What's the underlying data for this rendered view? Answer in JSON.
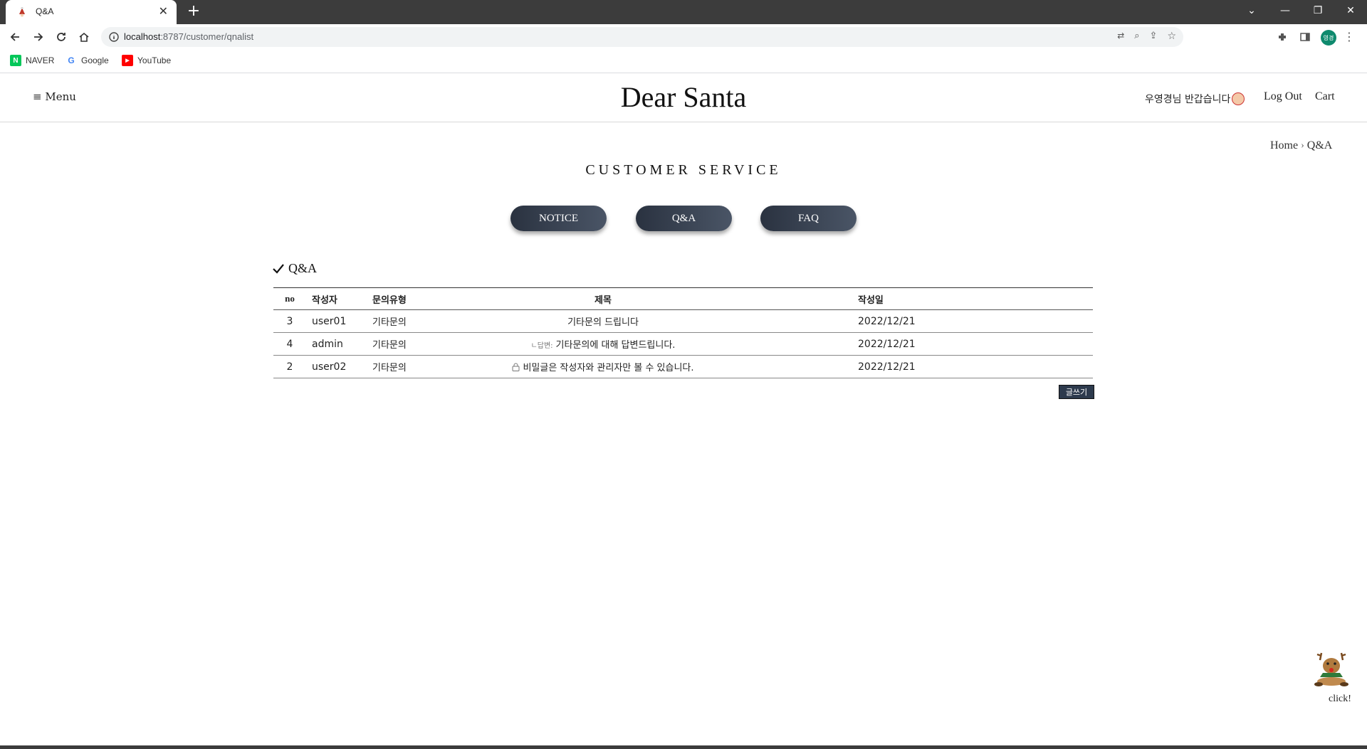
{
  "browser": {
    "tab_title": "Q&A",
    "url_host": "localhost",
    "url_path": ":8787/customer/qnalist",
    "bookmarks": [
      {
        "label": "NAVER",
        "icon": "naver-icon",
        "color": "#03c75a"
      },
      {
        "label": "Google",
        "icon": "google-icon",
        "color": "#4285f4"
      },
      {
        "label": "YouTube",
        "icon": "youtube-icon",
        "color": "#ff0000"
      }
    ],
    "profile_initials": "영경"
  },
  "header": {
    "menu_label": "≡ Menu",
    "brand": "Dear Santa",
    "greeting": "우영경님 반갑습니다",
    "logout_label": "Log Out",
    "cart_label": "Cart"
  },
  "breadcrumb": {
    "home": "Home",
    "current": "Q&A"
  },
  "page_title": "CUSTOMER SERVICE",
  "tabs": [
    "NOTICE",
    "Q&A",
    "FAQ"
  ],
  "section_title": "Q&A",
  "table": {
    "headers": [
      "no",
      "작성자",
      "문의유형",
      "제목",
      "작성일"
    ],
    "rows": [
      {
        "no": "3",
        "writer": "user01",
        "type": "기타문의",
        "title": "기타문의 드립니다",
        "date": "2022/12/21"
      },
      {
        "no": "4",
        "writer": "admin",
        "type": "기타문의",
        "reply_tag": "ㄴ답변:",
        "title": "기타문의에 대해 답변드립니다.",
        "date": "2022/12/21"
      },
      {
        "no": "2",
        "writer": "user02",
        "type": "기타문의",
        "title": "비밀글은 작성자와 관리자만 볼 수 있습니다.",
        "date": "2022/12/21"
      }
    ]
  },
  "write_button": "글쓰기",
  "deco_label": "click!",
  "colors": {
    "pill_dark": "#2a3240",
    "pill_light": "#4a5566",
    "write_btn": "#2d3a4d"
  }
}
